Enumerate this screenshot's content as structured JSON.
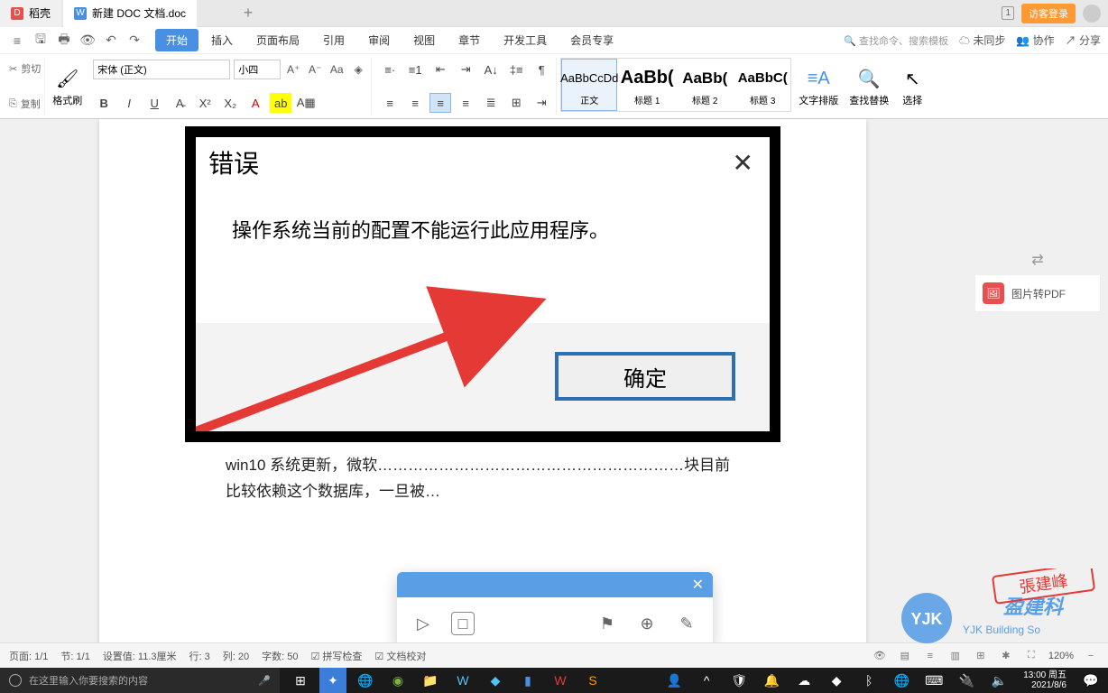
{
  "tabs": {
    "daoke": "稻壳",
    "doc": "新建 DOC 文档.doc"
  },
  "title_right": {
    "login": "访客登录"
  },
  "menu": {
    "tabs": [
      "开始",
      "插入",
      "页面布局",
      "引用",
      "审阅",
      "视图",
      "章节",
      "开发工具",
      "会员专享"
    ],
    "search_ph": "查找命令、搜索模板",
    "sync": "未同步",
    "collab": "协作",
    "share": "分享"
  },
  "ribbon": {
    "cut": "剪切",
    "copy": "复制",
    "format_painter": "格式刷",
    "font_name": "宋体 (正文)",
    "font_size": "小四",
    "styles": [
      {
        "preview": "AaBbCcDd",
        "label": "正文"
      },
      {
        "preview": "AaBb(",
        "label": "标题 1"
      },
      {
        "preview": "AaBb(",
        "label": "标题 2"
      },
      {
        "preview": "AaBbC(",
        "label": "标题 3"
      }
    ],
    "text_layout": "文字排版",
    "find_replace": "查找替换",
    "select": "选择"
  },
  "doc": {
    "dlg_title": "错误",
    "dlg_msg": "操作系统当前的配置不能运行此应用程序。",
    "dlg_ok": "确定",
    "body_text": "win10 系统更新，微软……………………………………………………块目前比较依赖这个数据库，一旦被…"
  },
  "right_panel": {
    "img2pdf": "图片转PDF"
  },
  "status": {
    "page": "页面: 1/1",
    "section": "节: 1/1",
    "pos": "设置值: 11.3厘米",
    "line": "行: 3",
    "col": "列: 20",
    "words": "字数: 50",
    "spell": "拼写检查",
    "proof": "文档校对",
    "zoom": "120%"
  },
  "taskbar": {
    "search_ph": "在这里输入你要搜索的内容",
    "time": "13:00",
    "day": "周五",
    "date": "2021/8/6"
  },
  "watermark": {
    "brand": "YJK",
    "cn": "盈建科",
    "en": "YJK Building So",
    "stamp": "張建峰"
  }
}
